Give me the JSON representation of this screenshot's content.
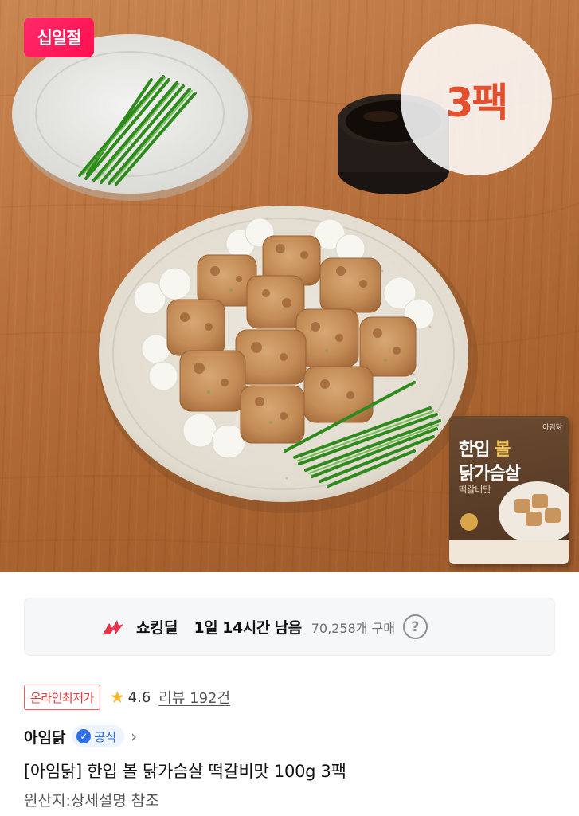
{
  "hero": {
    "event_badge": "십일절",
    "pack_badge": "3팩",
    "package": {
      "brand": "아임닭",
      "line1_prefix": "한입 ",
      "line1_highlight": "볼",
      "line2": "닭가슴살",
      "line3": "떡갈비맛"
    }
  },
  "deal": {
    "name": "쇼킹딜",
    "time_left": "1일 14시간 남음",
    "purchase_count": "70,258개 구매",
    "help_icon": "?"
  },
  "product": {
    "lowest_price_tag": "온라인최저가",
    "rating": "4.6",
    "reviews": "리뷰 192건",
    "seller": "아임닭",
    "official_label": "공식",
    "title": "[아임닭] 한입 볼 닭가슴살 떡갈비맛 100g 3팩",
    "origin": "원산지:상세설명 참조"
  },
  "colors": {
    "event_badge": "#ff1f5a",
    "pack_text": "#e2502d",
    "deal_accent": "#e8334a",
    "official_blue": "#2f6fe6",
    "star": "#f5b52c"
  }
}
